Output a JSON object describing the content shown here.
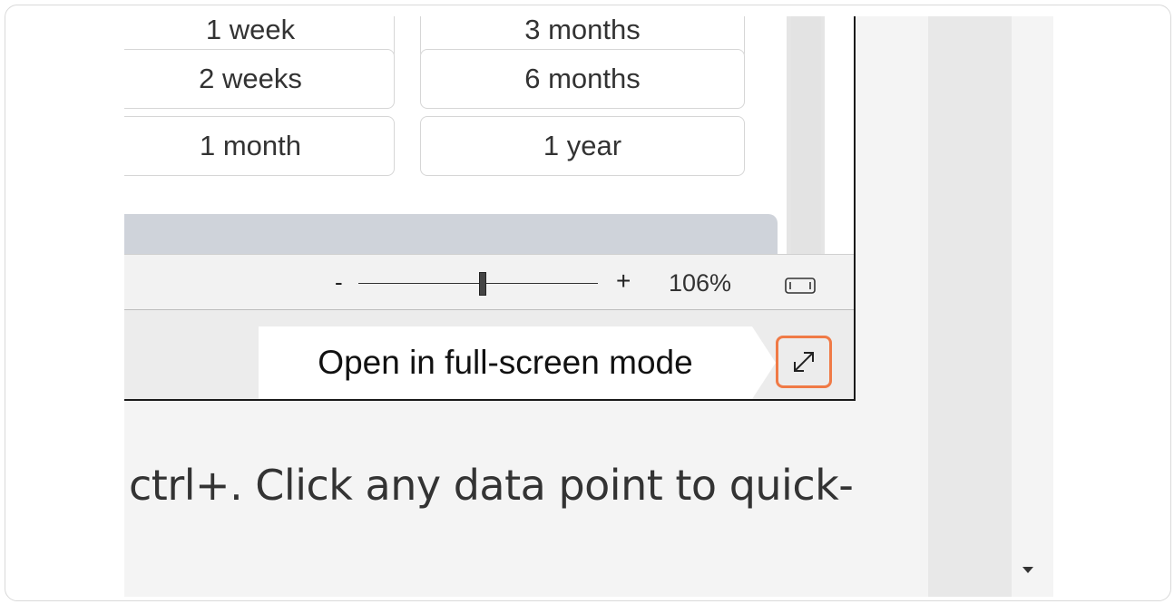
{
  "duration_options": {
    "left": [
      "1 week",
      "2 weeks",
      "1 month"
    ],
    "right": [
      "3 months",
      "6 months",
      "1 year"
    ]
  },
  "zoom": {
    "minus_label": "-",
    "plus_label": "+",
    "percent": "106%",
    "slider_level": 0.52
  },
  "fullscreen": {
    "tooltip": "Open in full-screen mode",
    "highlight_color": "#f07a46"
  },
  "article": {
    "text": "ctrl+. Click any data point to quick-"
  },
  "icons": {
    "fit": "fit-to-window-icon",
    "fullscreen": "expand-arrows-icon",
    "scroll": "scroll-down-arrow-icon"
  }
}
